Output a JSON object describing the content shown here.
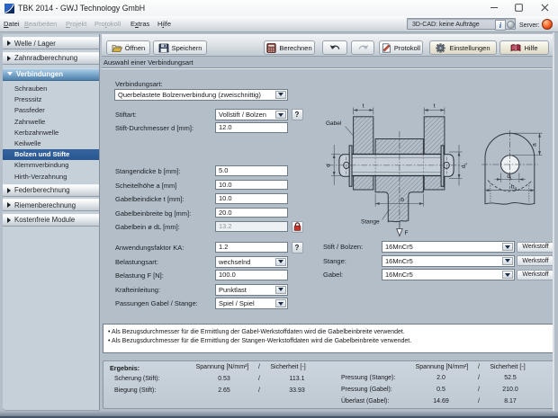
{
  "window": {
    "title": "TBK 2014 - GWJ Technology GmbH"
  },
  "menubar": {
    "items": [
      {
        "pre": "",
        "key": "D",
        "post": "atei",
        "enabled": true
      },
      {
        "pre": "",
        "key": "B",
        "post": "earbeiten",
        "enabled": false
      },
      {
        "pre": "",
        "key": "P",
        "post": "rojekt",
        "enabled": false
      },
      {
        "pre": "Pro",
        "key": "t",
        "post": "okoll",
        "enabled": false
      },
      {
        "pre": "E",
        "key": "x",
        "post": "tras",
        "enabled": true
      },
      {
        "pre": "H",
        "key": "i",
        "post": "lfe",
        "enabled": true
      }
    ],
    "cad_status": "3D-CAD: keine Aufträge",
    "info_glyph": "i",
    "server_label": "Server:"
  },
  "toolbar": {
    "open": "Öffnen",
    "save": "Speichern",
    "calculate": "Berechnen",
    "protocol": "Protokoll",
    "settings": "Einstellungen",
    "help": "Hilfe"
  },
  "sidebar": {
    "welle": "Welle / Lager",
    "zahnrad": "Zahnradberechnung",
    "verbindungen": "Verbindungen",
    "items": [
      "Schrauben",
      "Presssitz",
      "Passfeder",
      "Zahnwelle",
      "Kerbzahnwelle",
      "Keilwelle",
      "Bolzen und Stifte",
      "Klemmverbindung",
      "Hirth-Verzahnung"
    ],
    "feder": "Federberechnung",
    "riemen": "Riemenberechnung",
    "kostenfrei": "Kostenfreie Module"
  },
  "content": {
    "section_title": "Auswahl einer Verbindungsart",
    "verbindungsart_label": "Verbindungsart:",
    "verbindungsart_value": "Querbelastete Bolzenverbindung (zweischnittig)",
    "stiftart_label": "Stiftart:",
    "stiftart_value": "Vollstift / Bolzen",
    "help_glyph": "?",
    "rows": [
      {
        "label": "Stift-Durchmesser d [mm]:",
        "value": "12.0"
      },
      {
        "label": "Stangendicke b [mm]:",
        "value": "5.0"
      },
      {
        "label": "Scheitelhöhe a [mm]",
        "value": "10.0"
      },
      {
        "label": "Gabelbeindicke t [mm]:",
        "value": "10.0"
      },
      {
        "label": "Gabelbeinbreite bg [mm]:",
        "value": "20.0"
      },
      {
        "label": "Gabelbein ø dL [mm]:",
        "value": "13.2"
      }
    ],
    "ka_label": "Anwendungsfaktor KA:",
    "ka_value": "1.2",
    "belastungsart_label": "Belastungsart:",
    "belastungsart_value": "wechselnd",
    "belastung_label": "Belastung F [N]:",
    "belastung_value": "100.0",
    "kraft_label": "Krafteinleitung:",
    "kraft_value": "Punktlast",
    "passungen_label": "Passungen Gabel / Stange:",
    "passungen_value": "Spiel / Spiel",
    "materials": [
      {
        "label": "Stift / Bolzen:",
        "value": "16MnCr5",
        "button": "Werkstoff"
      },
      {
        "label": "Stange:",
        "value": "16MnCr5",
        "button": "Werkstoff"
      },
      {
        "label": "Gabel:",
        "value": "16MnCr5",
        "button": "Werkstoff"
      }
    ],
    "notes": [
      "• Als Bezugsdurchmesser für die Ermittlung der Gabel-Werkstoffdaten wird die Gabelbeinbreite verwendet.",
      "• Als Bezugsdurchmesser für die Ermittlung der Stangen-Werkstoffdaten wird die Gabelbeinbreite verwendet."
    ],
    "results": {
      "title": "Ergebnis:",
      "col_spannung": "Spannung [N/mm²]",
      "col_sicherheit": "Sicherheit [-]",
      "slash": "/",
      "left": [
        {
          "label": "Scherung (Stift):",
          "spannung": "0.53",
          "sicherheit": "113.1"
        },
        {
          "label": "Biegung (Stift):",
          "spannung": "2.65",
          "sicherheit": "33.93"
        }
      ],
      "right": [
        {
          "label": "Pressung (Stange):",
          "spannung": "2.0",
          "sicherheit": "52.5"
        },
        {
          "label": "Pressung (Gabel):",
          "spannung": "0.5",
          "sicherheit": "210.0"
        },
        {
          "label": "Überlast (Gabel):",
          "spannung": "14.69",
          "sicherheit": "8.17"
        }
      ]
    }
  },
  "drawing": {
    "gabel": "Gabel",
    "stange": "Stange",
    "t": "t",
    "d": "d",
    "b": "b",
    "a": "a",
    "f": "F",
    "dl_main": "d",
    "dl_sub": "L",
    "bg_main": "b",
    "bg_sub": "g"
  }
}
